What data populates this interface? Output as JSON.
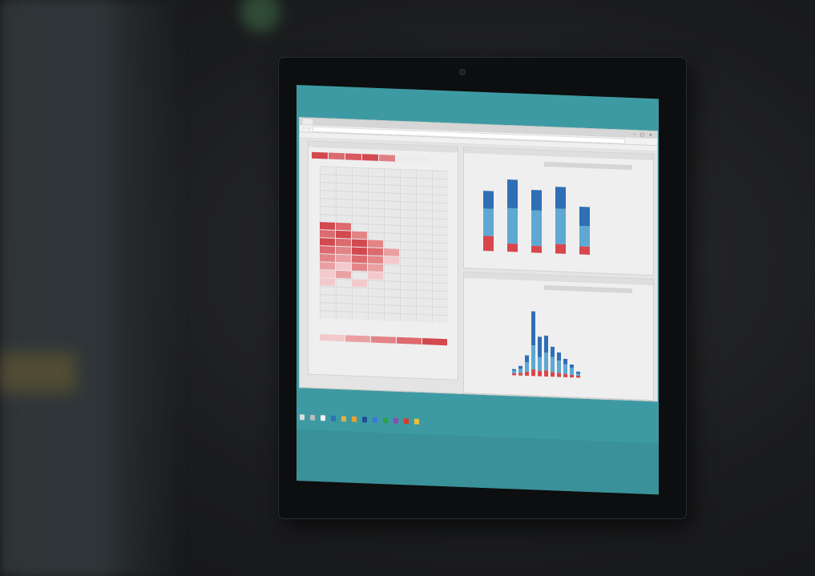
{
  "scene": {
    "description_label": "",
    "colors": {
      "screen_bg": "#3d9aa2",
      "heat_red": "#d2494f",
      "bar_red": "#d8474c",
      "bar_light_blue": "#5fa8d3",
      "bar_dark_blue": "#2f6fb5"
    }
  },
  "browser": {
    "tab_label": "",
    "window_controls": [
      "–",
      "□",
      "×"
    ]
  },
  "charts": {
    "stacked_bar": {
      "bars": [
        {
          "red": 22,
          "light": 40,
          "dark": 26
        },
        {
          "red": 12,
          "light": 52,
          "dark": 42
        },
        {
          "red": 10,
          "light": 52,
          "dark": 30
        },
        {
          "red": 14,
          "light": 52,
          "dark": 32
        },
        {
          "red": 12,
          "light": 30,
          "dark": 28
        }
      ]
    },
    "histogram": {
      "bars": [
        {
          "red": 3,
          "light": 4,
          "dark": 2
        },
        {
          "red": 4,
          "light": 6,
          "dark": 4
        },
        {
          "red": 6,
          "light": 14,
          "dark": 10
        },
        {
          "red": 10,
          "light": 35,
          "dark": 50
        },
        {
          "red": 8,
          "light": 20,
          "dark": 30
        },
        {
          "red": 9,
          "light": 26,
          "dark": 25
        },
        {
          "red": 7,
          "light": 22,
          "dark": 15
        },
        {
          "red": 6,
          "light": 18,
          "dark": 12
        },
        {
          "red": 5,
          "light": 14,
          "dark": 8
        },
        {
          "red": 4,
          "light": 10,
          "dark": 5
        },
        {
          "red": 3,
          "light": 3,
          "dark": 3
        }
      ]
    }
  }
}
